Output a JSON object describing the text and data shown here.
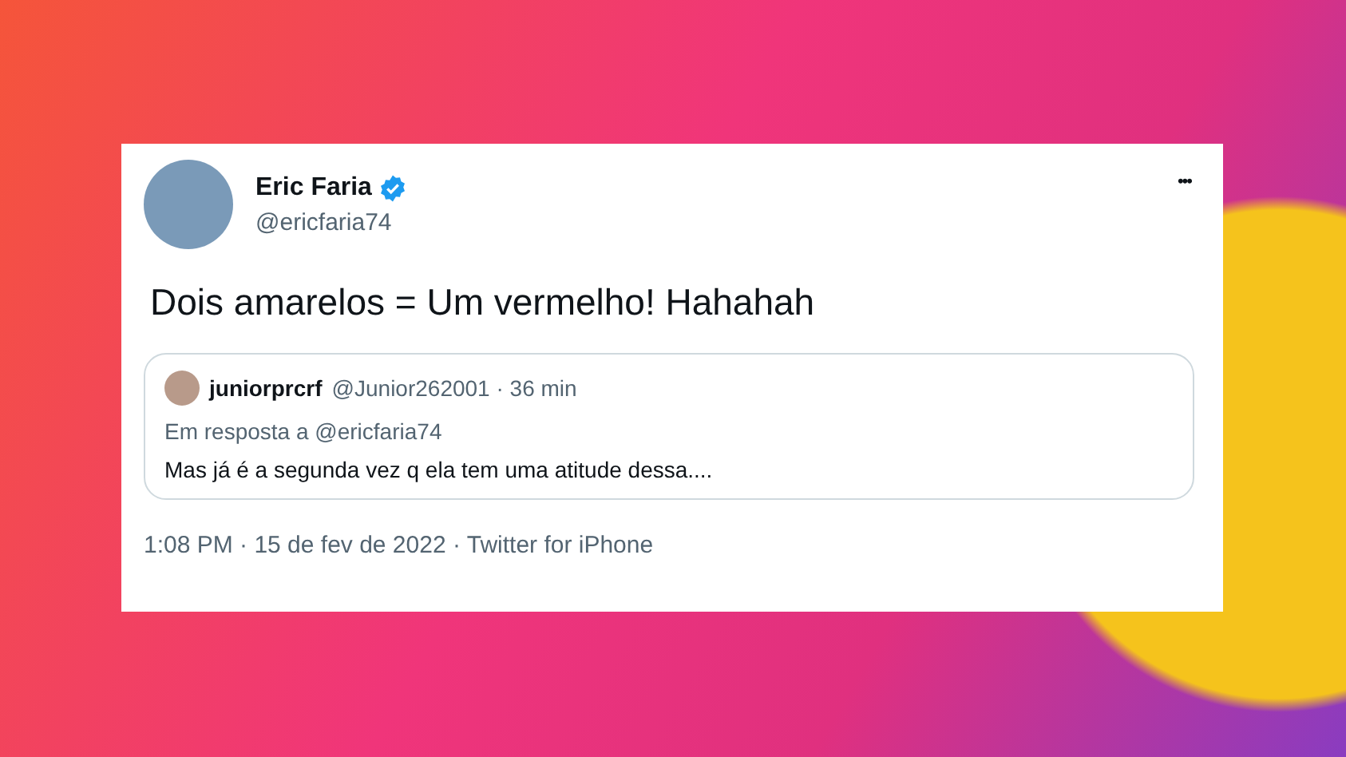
{
  "tweet": {
    "author": {
      "name": "Eric Faria",
      "handle": "@ericfaria74",
      "verified": true
    },
    "more_label": "•••",
    "text": "Dois amarelos = Um vermelho! Hahahah",
    "quoted": {
      "name": "juniorprcrf",
      "meta": "@Junior262001 · 36 min",
      "reply_to": "Em resposta a @ericfaria74",
      "text": "Mas já é a segunda vez q ela tem uma atitude dessa...."
    },
    "footer": "1:08 PM · 15 de fev de 2022 · Twitter for iPhone"
  }
}
